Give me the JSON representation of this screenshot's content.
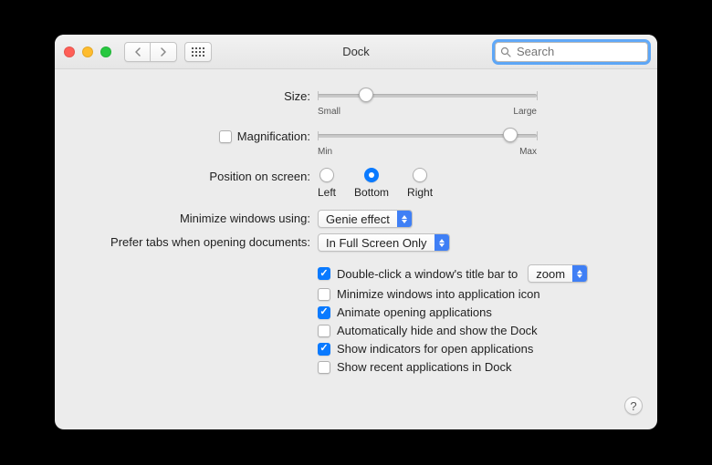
{
  "window": {
    "title": "Dock",
    "search_placeholder": "Search"
  },
  "labels": {
    "size": "Size:",
    "magnification": "Magnification:",
    "position": "Position on screen:",
    "minimize_using": "Minimize windows using:",
    "prefer_tabs": "Prefer tabs when opening documents:"
  },
  "sliders": {
    "size": {
      "min_label": "Small",
      "max_label": "Large",
      "value_pct": 22
    },
    "magnification": {
      "min_label": "Min",
      "max_label": "Max",
      "value_pct": 88,
      "enabled": false
    }
  },
  "position_options": {
    "left": "Left",
    "bottom": "Bottom",
    "right": "Right",
    "selected": "bottom"
  },
  "selects": {
    "minimize_effect": "Genie effect",
    "prefer_tabs": "In Full Screen Only",
    "titlebar_action": "zoom"
  },
  "checkboxes": {
    "magnification": false,
    "doubleclick_titlebar": {
      "label": "Double-click a window's title bar to",
      "checked": true
    },
    "minimize_into_icon": {
      "label": "Minimize windows into application icon",
      "checked": false
    },
    "animate_opening": {
      "label": "Animate opening applications",
      "checked": true
    },
    "autohide": {
      "label": "Automatically hide and show the Dock",
      "checked": false
    },
    "indicators": {
      "label": "Show indicators for open applications",
      "checked": true
    },
    "recent_apps": {
      "label": "Show recent applications in Dock",
      "checked": false
    }
  },
  "help_label": "?"
}
